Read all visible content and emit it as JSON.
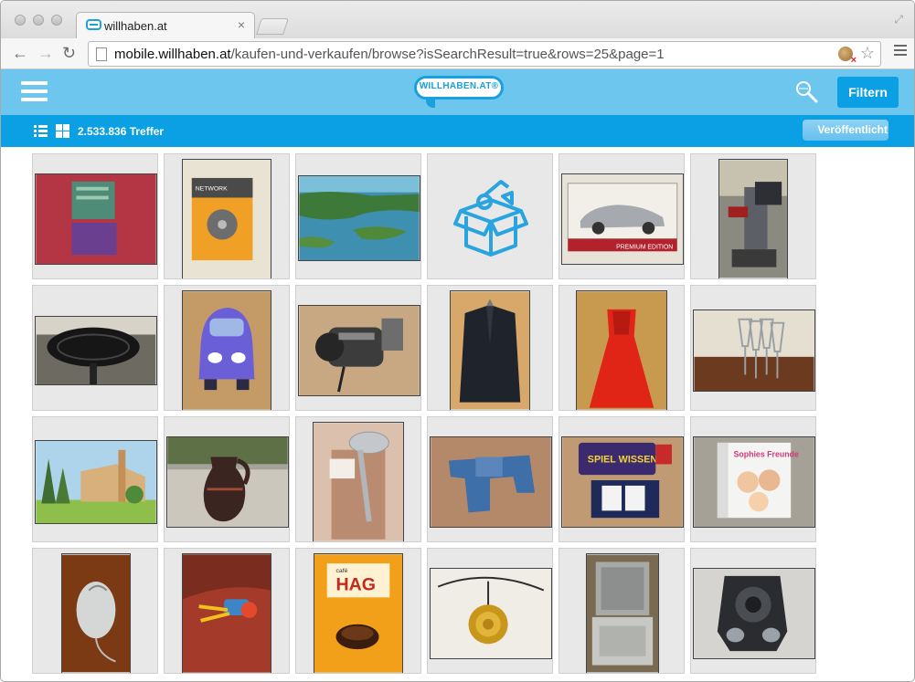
{
  "browser": {
    "tab_title": "willhaben.at",
    "tab_close": "×",
    "url_host": "mobile.willhaben.at",
    "url_path": "/kaufen-und-verkaufen/browse?isSearchResult=true&rows=25&page=1",
    "icons": [
      "back-icon",
      "forward-icon",
      "reload-icon",
      "page-icon",
      "extension-icon",
      "bookmark-star-icon",
      "chrome-menu-icon",
      "fullscreen-icon"
    ]
  },
  "header": {
    "logo_text": "WILLHABEN.AT®",
    "filter_label": "Filtern",
    "bg_color": "#6dc6ee",
    "accent_color": "#0ba0e3"
  },
  "results": {
    "count_text": "2.533.836 Treffer",
    "sort_label": "Veröffentlicht"
  },
  "listings": [
    {
      "name": "clothes-photo"
    },
    {
      "name": "network-hdd-photo"
    },
    {
      "name": "lake-postcard-photo"
    },
    {
      "name": "placeholder-box-image"
    },
    {
      "name": "model-car-photo"
    },
    {
      "name": "stand-item-photo"
    },
    {
      "name": "fan-photo"
    },
    {
      "name": "toy-car-photo"
    },
    {
      "name": "car-part-photo"
    },
    {
      "name": "suit-jacket-photo"
    },
    {
      "name": "red-dress-photo"
    },
    {
      "name": "glasses-photo"
    },
    {
      "name": "building-postcard-photo"
    },
    {
      "name": "jug-photo"
    },
    {
      "name": "shower-head-photo"
    },
    {
      "name": "dungarees-photo"
    },
    {
      "name": "game-box-photo"
    },
    {
      "name": "ds-game-photo"
    },
    {
      "name": "mouse-photo"
    },
    {
      "name": "toy-wheelbarrow-photo"
    },
    {
      "name": "coffee-pack-photo"
    },
    {
      "name": "rose-pendant-photo"
    },
    {
      "name": "machine-photo"
    },
    {
      "name": "speaker-photo"
    }
  ],
  "grid_text": {
    "network_box": "NETWORK",
    "premium_edition": "PREMIUM EDITION",
    "spiel_wissens": "SPIEL WISSENS",
    "sophies_freunde": "Sophies Freunde",
    "cafe": "café",
    "hag": "HAG"
  }
}
